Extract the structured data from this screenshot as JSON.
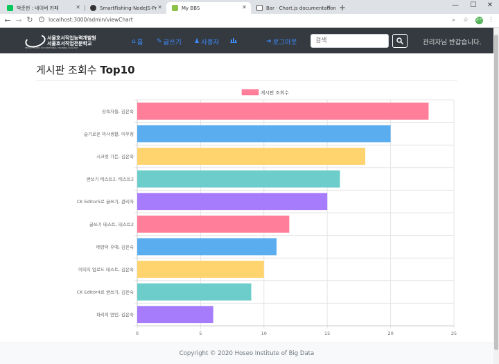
{
  "browser": {
    "tabs": [
      {
        "label": "박준헌 : 네이버 카페",
        "favicon_color": "#03c75a",
        "active": false
      },
      {
        "label": "SmartFishing-NodeJS-Project/tu",
        "favicon_color": "#333333",
        "active": false
      },
      {
        "label": "My BBS",
        "favicon_color": "#8bc34a",
        "active": true
      },
      {
        "label": "Bar · Chart.js documentation",
        "favicon_color": "#555555",
        "active": false
      }
    ],
    "tab_close": "✕",
    "new_tab": "+",
    "url": "localhost:3000/admin/viewChart",
    "avatar_text": "준헌"
  },
  "navbar": {
    "logo_line1": "서울호서직업능력개발원",
    "logo_line2": "서울호서직업전문학교",
    "logo_line3": "SEOUL HOSEO OCCUPATIONAL TRAINING COLLEGE",
    "links": [
      {
        "label": "홈",
        "icon": "home-icon"
      },
      {
        "label": "글쓰기",
        "icon": "edit-icon"
      },
      {
        "label": "사용자",
        "icon": "users-icon"
      },
      {
        "label": "",
        "icon": "chart-icon"
      },
      {
        "label": "로그아웃",
        "icon": "logout-icon"
      }
    ],
    "search_placeholder": "검색",
    "greeting": "관리자님 반갑습니다."
  },
  "page": {
    "title_prefix": "게시판 조회수 ",
    "title_bold": "Top10"
  },
  "chart_data": {
    "type": "bar",
    "orientation": "horizontal",
    "legend": {
      "label": "게시판 조회수",
      "position": "top"
    },
    "categories": [
      "상속자들, 김은숙",
      "슬기로운 의사생활, 이우정",
      "시크릿 가든, 김은숙",
      "글쓰기 테스트2, 테스트2",
      "CK Editor5로 글쓰기, 관리자",
      "글쓰기 테스트, 테스트2",
      "태양의 후예, 김은숙",
      "이미지 업로드 테스트, 김은숙",
      "CK Editor4로 글쓰기, 김은숙",
      "파리의 연인, 김은숙"
    ],
    "values": [
      23,
      20,
      18,
      16,
      15,
      12,
      11,
      10,
      9,
      6
    ],
    "colors": [
      "#ff7f9b",
      "#5aaeef",
      "#ffd46e",
      "#6ccdca",
      "#a67cfc",
      "#ff7f9b",
      "#5aaeef",
      "#ffd46e",
      "#6ccdca",
      "#a67cfc"
    ],
    "xlim": [
      0,
      25
    ],
    "xticks": [
      0,
      5,
      10,
      15,
      20,
      25
    ],
    "grid": true
  },
  "footer": {
    "text": "Copyright © 2020 Hoseo Institute of Big Data"
  }
}
